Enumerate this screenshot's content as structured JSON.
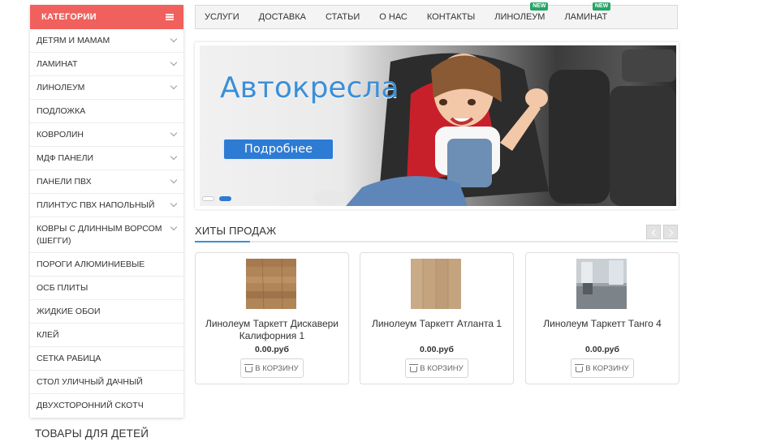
{
  "sidebar": {
    "header": "КАТЕГОРИИ",
    "items": [
      {
        "label": "ДЕТЯМ И МАМАМ",
        "has_submenu": true
      },
      {
        "label": "ЛАМИНАТ",
        "has_submenu": true
      },
      {
        "label": "ЛИНОЛЕУМ",
        "has_submenu": true
      },
      {
        "label": "ПОДЛОЖКА",
        "has_submenu": false
      },
      {
        "label": "КОВРОЛИН",
        "has_submenu": true
      },
      {
        "label": "МДФ ПАНЕЛИ",
        "has_submenu": true
      },
      {
        "label": "ПАНЕЛИ ПВХ",
        "has_submenu": true
      },
      {
        "label": "ПЛИНТУС ПВХ НАПОЛЬНЫЙ",
        "has_submenu": true
      },
      {
        "label": "КОВРЫ С ДЛИННЫМ ВОРСОМ (ШЕГГИ)",
        "has_submenu": true
      },
      {
        "label": "ПОРОГИ АЛЮМИНИЕВЫЕ",
        "has_submenu": false
      },
      {
        "label": "ОСБ ПЛИТЫ",
        "has_submenu": false
      },
      {
        "label": "ЖИДКИЕ ОБОИ",
        "has_submenu": false
      },
      {
        "label": "КЛЕЙ",
        "has_submenu": false
      },
      {
        "label": "СЕТКА РАБИЦА",
        "has_submenu": false
      },
      {
        "label": "СТОЛ УЛИЧНЫЙ ДАЧНЫЙ",
        "has_submenu": false
      },
      {
        "label": "ДВУХСТОРОННИЙ СКОТЧ",
        "has_submenu": false
      }
    ]
  },
  "section_kids": "ТОВАРЫ ДЛЯ ДЕТЕЙ",
  "nav": {
    "items": [
      {
        "label": "УСЛУГИ",
        "badge": ""
      },
      {
        "label": "ДОСТАВКА",
        "badge": ""
      },
      {
        "label": "СТАТЬИ",
        "badge": ""
      },
      {
        "label": "О НАС",
        "badge": ""
      },
      {
        "label": "КОНТАКТЫ",
        "badge": ""
      },
      {
        "label": "ЛИНОЛЕУМ",
        "badge": "NEW"
      },
      {
        "label": "ЛАМИНАТ",
        "badge": "NEW"
      }
    ]
  },
  "banner": {
    "title": "Автокресла",
    "button_label": "Подробнее",
    "slides": 2,
    "active_slide": 2
  },
  "hits": {
    "title": "ХИТЫ ПРОДАЖ",
    "products": [
      {
        "name": "Линолеум Таркетт Дискавери Калифорния 1",
        "price": "0.00.руб",
        "cart_label": "В КОРЗИНУ"
      },
      {
        "name": "Линолеум Таркетт Атланта 1",
        "price": "0.00.руб",
        "cart_label": "В КОРЗИНУ"
      },
      {
        "name": "Линолеум Таркетт Танго 4",
        "price": "0.00.руб",
        "cart_label": "В КОРЗИНУ"
      }
    ]
  },
  "colors": {
    "sidebar_header": "#f0605d",
    "accent_blue": "#3d8fd8",
    "badge_green": "#27a466"
  }
}
